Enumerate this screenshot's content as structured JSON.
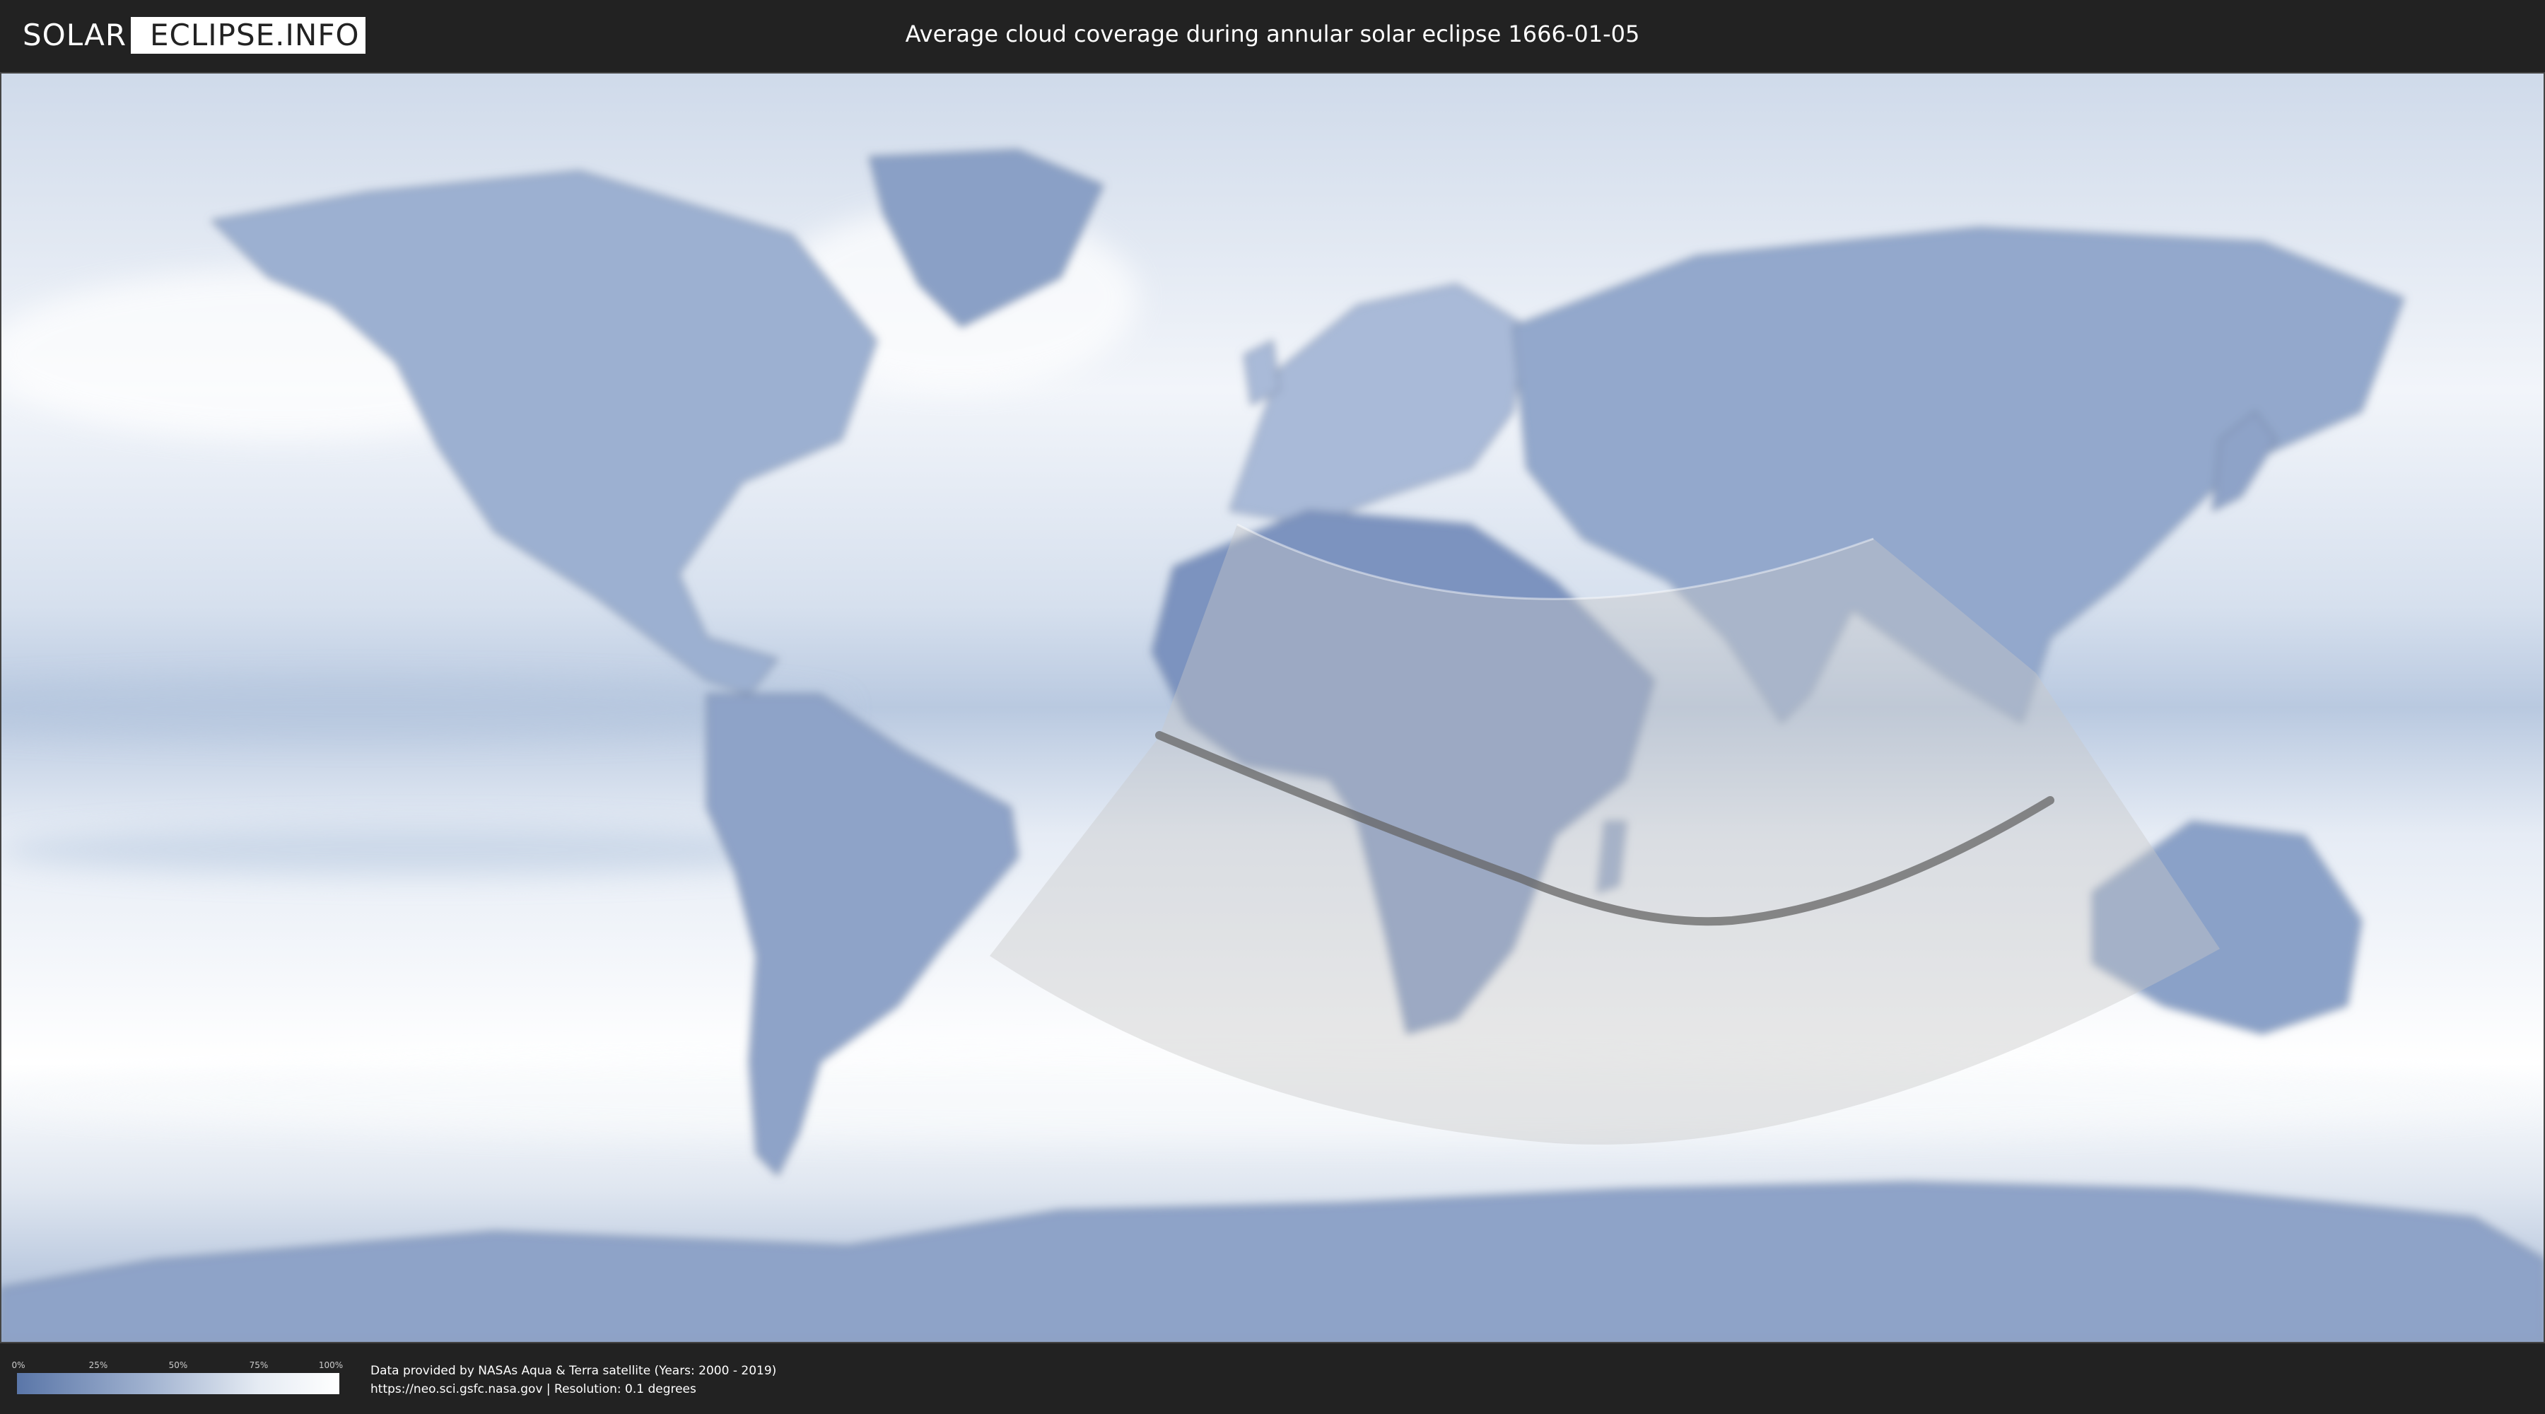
{
  "header": {
    "logo_left": "SOLAR",
    "logo_right": "ECLIPSE.INFO",
    "title": "Average cloud coverage during annular solar eclipse 1666-01-05"
  },
  "legend": {
    "ticks": [
      "0%",
      "25%",
      "50%",
      "75%",
      "100%"
    ],
    "colors": {
      "low": "#5a76a8",
      "high": "#ffffff"
    }
  },
  "credits": {
    "line1": "Data provided by NASAs Aqua & Terra satellite (Years: 2000 - 2019)",
    "line2": "https://neo.sci.gsfc.nasa.gov | Resolution: 0.1 degrees"
  },
  "map": {
    "projection": "equirectangular",
    "ocean_color": "#eef2f8",
    "land_color": "#7f96be",
    "eclipse_zone_color": "#c8c8c8",
    "central_line_color": "#666666"
  }
}
